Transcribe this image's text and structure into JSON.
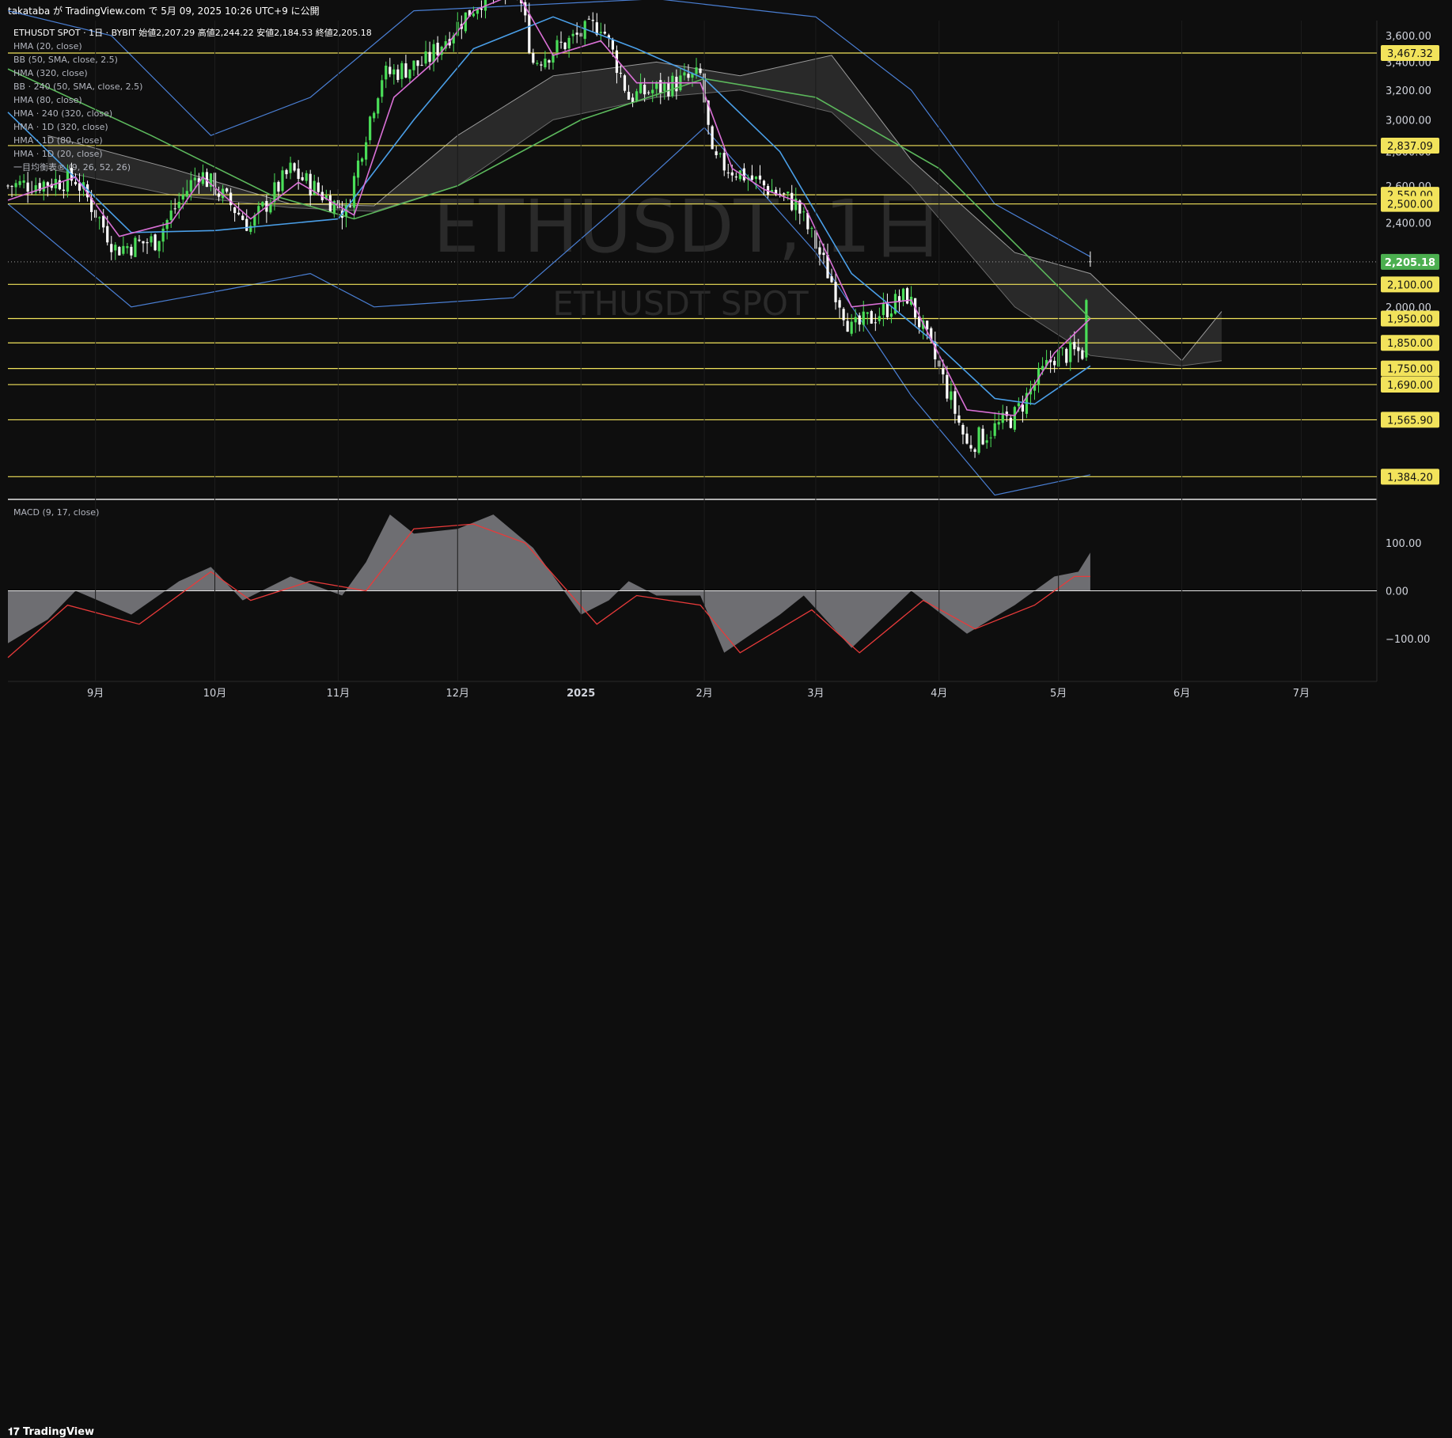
{
  "header": {
    "publish_text": "takataba が TradingView.com で 5月 09, 2025 10:26 UTC+9 に公開"
  },
  "watermark": {
    "symbol": "ETHUSDT, 1日",
    "description": "ETHUSDT SPOT"
  },
  "legend": {
    "title": "ETHUSDT SPOT · 1日 · BYBIT  始値2,207.29  高値2,244.22  安値2,184.53  終値2,205.18",
    "indicators": [
      "HMA (20, close)",
      "BB (50, SMA, close, 2.5)",
      "HMA (320, close)",
      "BB · 240 (50, SMA, close, 2.5)",
      "HMA (80, close)",
      "HMA · 240 (320, close)",
      "HMA · 1D (320, close)",
      "HMA · 1D (80, close)",
      "HMA · 1D (20, close)",
      "一目均衡表® (9, 26, 52, 26)"
    ]
  },
  "macd_legend": "MACD (9, 17, close)",
  "footer": {
    "logo_icon": "𝟏𝟕",
    "logo_text": "TradingView"
  },
  "colors": {
    "up": "#4ade58",
    "down": "#ffffff",
    "hma20": "#da70d6",
    "hma80": "#4a9fe8",
    "hma320": "#5cb85c",
    "bb": "#4a7fd4",
    "level": "#f2e35b",
    "last": "#4caf50",
    "macd_fill": "#6e6e72",
    "signal": "#e83a3a",
    "cloud": "#2e2e2e",
    "grid": "#1c1c1c"
  },
  "chart_data": {
    "type": "candlestick",
    "symbol": "ETHUSDT",
    "timeframe": "1日",
    "exchange": "BYBIT",
    "ohlc_last": {
      "open": 2207.29,
      "high": 2244.22,
      "low": 2184.53,
      "close": 2205.18
    },
    "x_start_date": "2024-08-10",
    "x_end_date": "2025-07-20",
    "last_candle_date": "2025-05-09",
    "ylim": [
      1320,
      3720
    ],
    "y_scale": "log",
    "y_ticks": [
      2000,
      2200,
      2400,
      2600,
      2800,
      3000,
      3200,
      3400,
      3600
    ],
    "y_tick_labels": [
      "2,000.00",
      "2,200.00",
      "2,400.00",
      "2,600.00",
      "2,800.00",
      "3,000.00",
      "3,200.00",
      "3,400.00",
      "3,600.00"
    ],
    "x_tick_dates": [
      "2024-09-01",
      "2024-10-01",
      "2024-11-01",
      "2024-12-01",
      "2025-01-01",
      "2025-02-01",
      "2025-03-01",
      "2025-04-01",
      "2025-05-01",
      "2025-06-01",
      "2025-07-01"
    ],
    "x_tick_labels": [
      "9月",
      "10月",
      "11月",
      "12月",
      "2025",
      "2月",
      "3月",
      "4月",
      "5月",
      "6月",
      "7月"
    ],
    "last_price": 2205.18,
    "last_price_label": "2,205.18",
    "horizontal_levels": [
      3467.32,
      2837.09,
      2550,
      2500,
      2100,
      1950,
      1850,
      1750,
      1690,
      1565.9,
      1384.2
    ],
    "horizontal_level_labels": [
      "3,467.32",
      "2,837.09",
      "2,550.00",
      "2,500.00",
      "2,100.00",
      "1,950.00",
      "1,850.00",
      "1,750.00",
      "1,690.00",
      "1,565.90",
      "1,384.20"
    ],
    "close_path": [
      [
        "2024-08-10",
        2600
      ],
      [
        "2024-08-20",
        2620
      ],
      [
        "2024-08-27",
        2640
      ],
      [
        "2024-09-06",
        2270
      ],
      [
        "2024-09-16",
        2310
      ],
      [
        "2024-09-27",
        2680
      ],
      [
        "2024-10-10",
        2380
      ],
      [
        "2024-10-20",
        2690
      ],
      [
        "2024-11-03",
        2450
      ],
      [
        "2024-11-12",
        3300
      ],
      [
        "2024-11-23",
        3400
      ],
      [
        "2024-12-07",
        3900
      ],
      [
        "2024-12-16",
        4000
      ],
      [
        "2024-12-20",
        3400
      ],
      [
        "2025-01-06",
        3700
      ],
      [
        "2025-01-13",
        3150
      ],
      [
        "2025-01-31",
        3300
      ],
      [
        "2025-02-03",
        2750
      ],
      [
        "2025-02-12",
        2650
      ],
      [
        "2025-02-24",
        2500
      ],
      [
        "2025-03-10",
        1900
      ],
      [
        "2025-03-24",
        2050
      ],
      [
        "2025-04-08",
        1480
      ],
      [
        "2025-04-20",
        1580
      ],
      [
        "2025-04-30",
        1800
      ],
      [
        "2025-05-07",
        1815
      ],
      [
        "2025-05-09",
        2205
      ]
    ],
    "hma_20": [
      [
        "2024-08-10",
        2520
      ],
      [
        "2024-08-27",
        2650
      ],
      [
        "2024-09-07",
        2330
      ],
      [
        "2024-09-20",
        2400
      ],
      [
        "2024-09-28",
        2650
      ],
      [
        "2024-10-10",
        2420
      ],
      [
        "2024-10-22",
        2620
      ],
      [
        "2024-11-05",
        2440
      ],
      [
        "2024-11-15",
        3150
      ],
      [
        "2024-11-25",
        3400
      ],
      [
        "2024-12-05",
        3800
      ],
      [
        "2024-12-16",
        3950
      ],
      [
        "2024-12-25",
        3450
      ],
      [
        "2025-01-06",
        3560
      ],
      [
        "2025-01-15",
        3250
      ],
      [
        "2025-01-31",
        3250
      ],
      [
        "2025-02-08",
        2700
      ],
      [
        "2025-02-16",
        2580
      ],
      [
        "2025-02-26",
        2500
      ],
      [
        "2025-03-10",
        2000
      ],
      [
        "2025-03-25",
        2030
      ],
      [
        "2025-04-08",
        1600
      ],
      [
        "2025-04-20",
        1580
      ],
      [
        "2025-04-30",
        1810
      ],
      [
        "2025-05-09",
        1950
      ]
    ],
    "hma_80": [
      [
        "2024-08-10",
        3050
      ],
      [
        "2024-09-10",
        2350
      ],
      [
        "2024-10-01",
        2360
      ],
      [
        "2024-11-01",
        2420
      ],
      [
        "2024-11-20",
        3000
      ],
      [
        "2024-12-05",
        3500
      ],
      [
        "2024-12-25",
        3750
      ],
      [
        "2025-01-15",
        3500
      ],
      [
        "2025-02-01",
        3280
      ],
      [
        "2025-02-20",
        2800
      ],
      [
        "2025-03-10",
        2150
      ],
      [
        "2025-03-31",
        1850
      ],
      [
        "2025-04-15",
        1640
      ],
      [
        "2025-04-25",
        1620
      ],
      [
        "2025-05-09",
        1760
      ]
    ],
    "hma_320": [
      [
        "2024-08-10",
        3350
      ],
      [
        "2024-09-15",
        2900
      ],
      [
        "2024-10-15",
        2550
      ],
      [
        "2024-11-05",
        2420
      ],
      [
        "2024-12-01",
        2600
      ],
      [
        "2025-01-01",
        3000
      ],
      [
        "2025-02-01",
        3280
      ],
      [
        "2025-03-01",
        3150
      ],
      [
        "2025-04-01",
        2700
      ],
      [
        "2025-04-25",
        2200
      ],
      [
        "2025-05-09",
        1950
      ]
    ],
    "bb_upper": [
      [
        "2024-08-10",
        3800
      ],
      [
        "2024-09-05",
        3600
      ],
      [
        "2024-09-30",
        2900
      ],
      [
        "2024-10-25",
        3150
      ],
      [
        "2024-11-20",
        3800
      ],
      [
        "2025-01-20",
        3900
      ],
      [
        "2025-03-01",
        3750
      ],
      [
        "2025-03-25",
        3200
      ],
      [
        "2025-04-15",
        2500
      ],
      [
        "2025-05-09",
        2230
      ]
    ],
    "bb_lower": [
      [
        "2024-08-10",
        2500
      ],
      [
        "2024-09-10",
        2000
      ],
      [
        "2024-10-05",
        2080
      ],
      [
        "2024-10-25",
        2150
      ],
      [
        "2024-11-10",
        2000
      ],
      [
        "2024-12-15",
        2040
      ],
      [
        "2025-01-10",
        2480
      ],
      [
        "2025-02-01",
        2950
      ],
      [
        "2025-03-01",
        2250
      ],
      [
        "2025-03-25",
        1650
      ],
      [
        "2025-04-15",
        1330
      ],
      [
        "2025-05-09",
        1390
      ]
    ],
    "ichimoku_span_a": [
      [
        "2024-08-20",
        2900
      ],
      [
        "2024-09-20",
        2700
      ],
      [
        "2024-10-20",
        2500
      ],
      [
        "2024-11-10",
        2490
      ],
      [
        "2024-12-01",
        2900
      ],
      [
        "2024-12-25",
        3300
      ],
      [
        "2025-01-20",
        3400
      ],
      [
        "2025-02-10",
        3300
      ],
      [
        "2025-03-05",
        3450
      ],
      [
        "2025-03-25",
        2750
      ],
      [
        "2025-04-20",
        2250
      ],
      [
        "2025-05-09",
        2150
      ],
      [
        "2025-06-01",
        1780
      ],
      [
        "2025-06-11",
        1980
      ]
    ],
    "ichimoku_span_b": [
      [
        "2024-08-20",
        2700
      ],
      [
        "2024-09-20",
        2550
      ],
      [
        "2024-10-20",
        2480
      ],
      [
        "2024-11-10",
        2460
      ],
      [
        "2024-12-01",
        2600
      ],
      [
        "2024-12-25",
        3000
      ],
      [
        "2025-01-20",
        3150
      ],
      [
        "2025-02-10",
        3200
      ],
      [
        "2025-03-05",
        3050
      ],
      [
        "2025-03-25",
        2600
      ],
      [
        "2025-04-20",
        2000
      ],
      [
        "2025-05-09",
        1800
      ],
      [
        "2025-06-01",
        1760
      ],
      [
        "2025-06-11",
        1780
      ]
    ],
    "macd": {
      "ylim": [
        -190,
        190
      ],
      "y_ticks": [
        100,
        0,
        -100
      ],
      "y_tick_labels": [
        "100.00",
        "0.00",
        "−100.00"
      ],
      "histogram": [
        [
          "2024-08-10",
          -110
        ],
        [
          "2024-08-20",
          -60
        ],
        [
          "2024-08-27",
          0
        ],
        [
          "2024-09-10",
          -50
        ],
        [
          "2024-09-22",
          20
        ],
        [
          "2024-09-30",
          50
        ],
        [
          "2024-10-08",
          -20
        ],
        [
          "2024-10-20",
          30
        ],
        [
          "2024-11-02",
          -10
        ],
        [
          "2024-11-08",
          60
        ],
        [
          "2024-11-14",
          160
        ],
        [
          "2024-11-20",
          120
        ],
        [
          "2024-12-01",
          130
        ],
        [
          "2024-12-10",
          160
        ],
        [
          "2024-12-20",
          90
        ],
        [
          "2025-01-01",
          -50
        ],
        [
          "2025-01-08",
          -20
        ],
        [
          "2025-01-13",
          20
        ],
        [
          "2025-01-20",
          -10
        ],
        [
          "2025-01-31",
          -10
        ],
        [
          "2025-02-06",
          -130
        ],
        [
          "2025-02-20",
          -50
        ],
        [
          "2025-02-26",
          -10
        ],
        [
          "2025-03-10",
          -120
        ],
        [
          "2025-03-25",
          0
        ],
        [
          "2025-04-08",
          -90
        ],
        [
          "2025-04-20",
          -30
        ],
        [
          "2025-04-30",
          30
        ],
        [
          "2025-05-06",
          40
        ],
        [
          "2025-05-09",
          80
        ]
      ],
      "signal": [
        [
          "2024-08-10",
          -140
        ],
        [
          "2024-08-25",
          -30
        ],
        [
          "2024-09-12",
          -70
        ],
        [
          "2024-09-30",
          40
        ],
        [
          "2024-10-10",
          -20
        ],
        [
          "2024-10-25",
          20
        ],
        [
          "2024-11-08",
          0
        ],
        [
          "2024-11-20",
          130
        ],
        [
          "2024-12-05",
          140
        ],
        [
          "2024-12-18",
          100
        ],
        [
          "2025-01-05",
          -70
        ],
        [
          "2025-01-15",
          -10
        ],
        [
          "2025-01-31",
          -30
        ],
        [
          "2025-02-10",
          -130
        ],
        [
          "2025-02-28",
          -40
        ],
        [
          "2025-03-12",
          -130
        ],
        [
          "2025-03-28",
          -20
        ],
        [
          "2025-04-10",
          -80
        ],
        [
          "2025-04-25",
          -30
        ],
        [
          "2025-05-05",
          30
        ],
        [
          "2025-05-09",
          30
        ]
      ]
    }
  }
}
